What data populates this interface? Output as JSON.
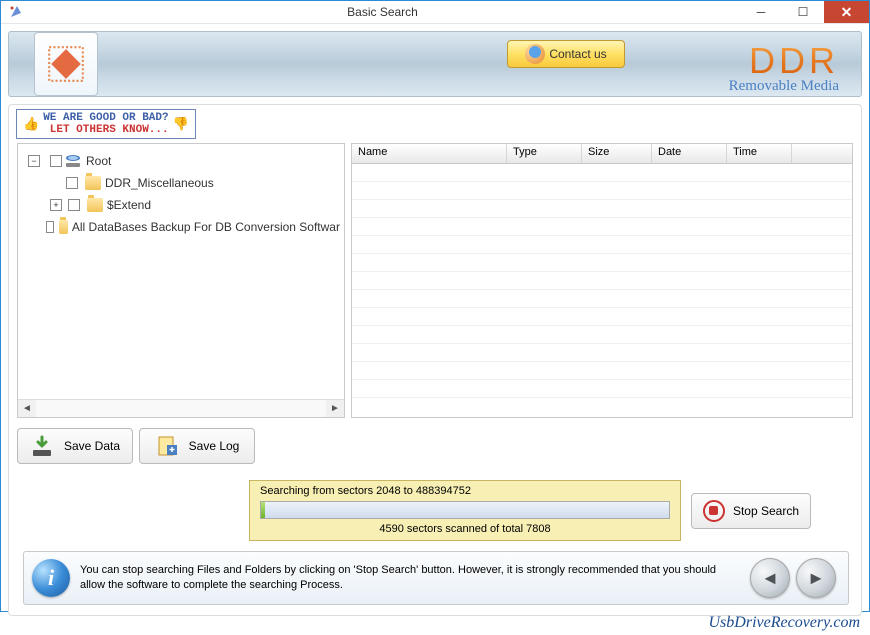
{
  "window": {
    "title": "Basic Search"
  },
  "header": {
    "contact_label": "Contact us",
    "brand_main": "DDR",
    "brand_sub": "Removable Media"
  },
  "feedback": {
    "line1": "WE ARE GOOD OR BAD?",
    "line2": "LET OTHERS KNOW..."
  },
  "tree": {
    "root_label": "Root",
    "nodes": {
      "misc": "DDR_Miscellaneous",
      "extend": "$Extend",
      "dbbackup": "All DataBases Backup For DB Conversion Softwar"
    }
  },
  "grid": {
    "columns": {
      "name": "Name",
      "type": "Type",
      "size": "Size",
      "date": "Date",
      "time": "Time"
    }
  },
  "buttons": {
    "save_data": "Save Data",
    "save_log": "Save Log",
    "stop_search": "Stop Search"
  },
  "progress": {
    "label": "Searching from sectors 2048 to 488394752",
    "scanned_text": "4590  sectors scanned of total 7808",
    "percent": 1
  },
  "hint": "You can stop searching Files and Folders by clicking on 'Stop Search' button. However, it is strongly recommended that you should allow the software to complete the searching Process.",
  "footer": {
    "link_text": "UsbDriveRecovery.com"
  }
}
